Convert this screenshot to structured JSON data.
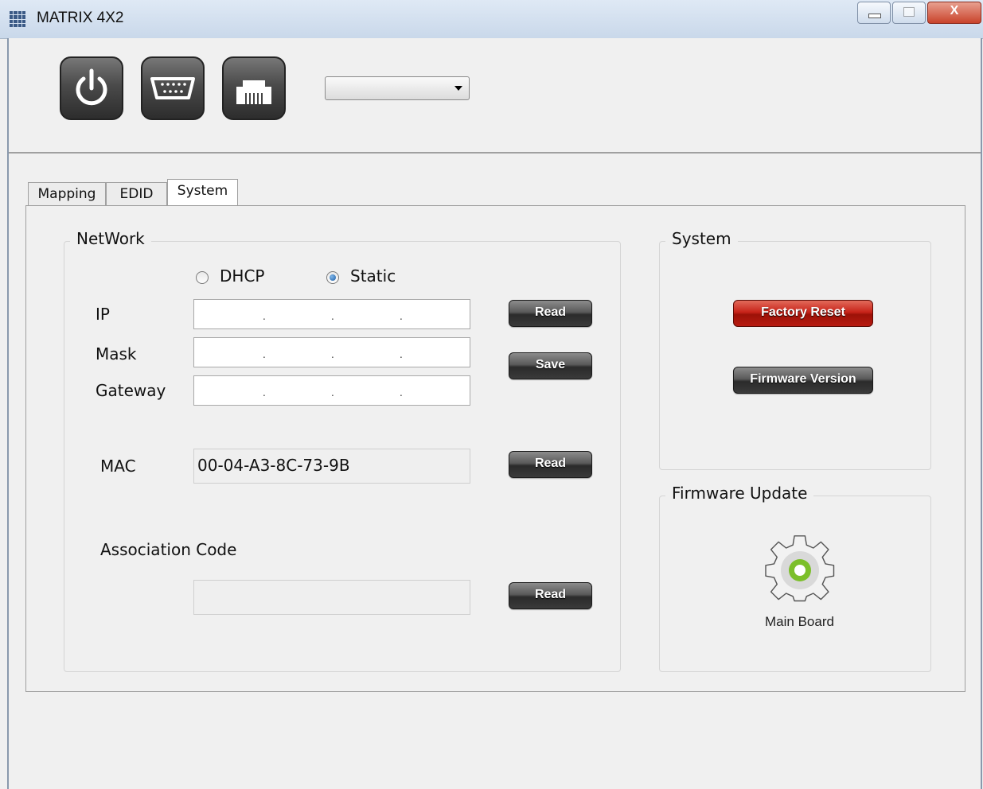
{
  "window": {
    "title": "MATRIX 4X2"
  },
  "toolbar": {
    "icons": [
      "power-icon",
      "serial-port-icon",
      "ethernet-port-icon"
    ],
    "port_select_value": ""
  },
  "tabs": [
    {
      "label": "Mapping",
      "active": false
    },
    {
      "label": "EDID",
      "active": false
    },
    {
      "label": "System",
      "active": true
    }
  ],
  "network": {
    "title": "NetWork",
    "mode_options": [
      {
        "label": "DHCP",
        "selected": false
      },
      {
        "label": "Static",
        "selected": true
      }
    ],
    "ip_label": "IP",
    "mask_label": "Mask",
    "gateway_label": "Gateway",
    "ip_separators": ".",
    "read_button": "Read",
    "save_button": "Save",
    "mac_label": "MAC",
    "mac_value": "00-04-A3-8C-73-9B",
    "mac_read_button": "Read",
    "association_label": "Association Code",
    "association_value": "",
    "association_read_button": "Read"
  },
  "system": {
    "title": "System",
    "factory_reset_button": "Factory Reset",
    "firmware_version_button": "Firmware Version"
  },
  "firmware_update": {
    "title": "Firmware Update",
    "main_board_label": "Main Board"
  },
  "colors": {
    "danger_button": "#c8241a",
    "dark_button": "#3a3a3a",
    "gear_ring": "#7cbf2a"
  }
}
